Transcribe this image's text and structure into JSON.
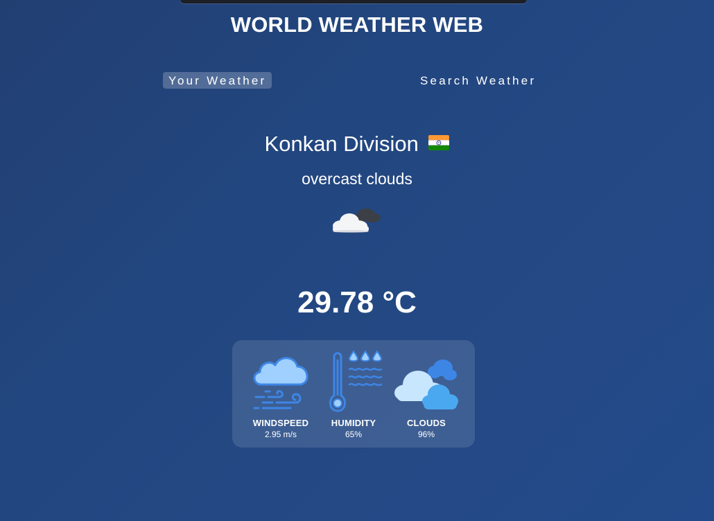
{
  "app": {
    "title": "WORLD WEATHER WEB"
  },
  "tabs": [
    {
      "label": "Your Weather",
      "active": true
    },
    {
      "label": "Search Weather",
      "active": false
    }
  ],
  "weather": {
    "city": "Konkan Division",
    "country_flag_icon": "india-flag-icon",
    "description": "overcast clouds",
    "condition_icon": "cloud-with-dark-cloud-icon",
    "temperature": "29.78 °C"
  },
  "stats": [
    {
      "icon": "wind-cloud-icon",
      "label": "WINDSPEED",
      "value": "2.95 m/s"
    },
    {
      "icon": "thermometer-humidity-icon",
      "label": "HUMIDITY",
      "value": "65%"
    },
    {
      "icon": "clouds-icon",
      "label": "CLOUDS",
      "value": "96%"
    }
  ],
  "colors": {
    "background": "#234a8a",
    "icon_blue": "#3d86e6",
    "icon_light_blue": "#9fd0ff"
  }
}
